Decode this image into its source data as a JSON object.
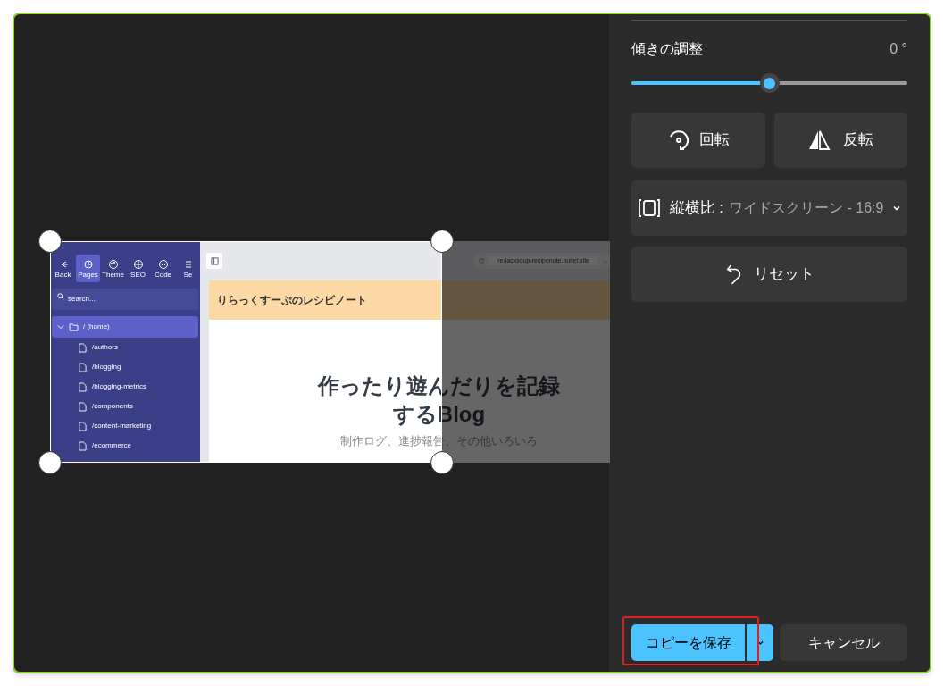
{
  "preview": {
    "toolbar": [
      {
        "label": "Back",
        "selected": false
      },
      {
        "label": "Pages",
        "selected": true
      },
      {
        "label": "Theme",
        "selected": false
      },
      {
        "label": "SEO",
        "selected": false
      },
      {
        "label": "Code",
        "selected": false
      },
      {
        "label": "Se",
        "selected": false
      }
    ],
    "search": {
      "placeholder": "search..."
    },
    "tree": [
      {
        "label": "/ (home)",
        "selected": true,
        "expanded": true,
        "children": [
          {
            "label": "/authors",
            "selected": false
          },
          {
            "label": "/blogging",
            "selected": false
          },
          {
            "label": "/blogging-metrics",
            "selected": false
          },
          {
            "label": "/components",
            "selected": false
          },
          {
            "label": "/content-marketing",
            "selected": false
          },
          {
            "label": "/ecommerce",
            "selected": false
          }
        ]
      }
    ],
    "url": "re-lacksoup-recipenote.bullet.site",
    "banner": "りらっくすーぷのレシピノート",
    "heading": [
      "作ったり遊んだりを記録",
      "するBlog"
    ],
    "subtitle": "制作ログ、進捗報告、その他いろいろ"
  },
  "panel": {
    "straighten": {
      "label": "傾きの調整",
      "reading": "0 °",
      "level": 0.5
    },
    "rotate": "回転",
    "flip": "反転",
    "aspect": {
      "label": "縦横比 :",
      "value": "ワイドスクリーン - 16:9"
    },
    "reset": "リセット",
    "save": "コピーを保存",
    "cancel": "キャンセル",
    "save_highlighted": true
  }
}
